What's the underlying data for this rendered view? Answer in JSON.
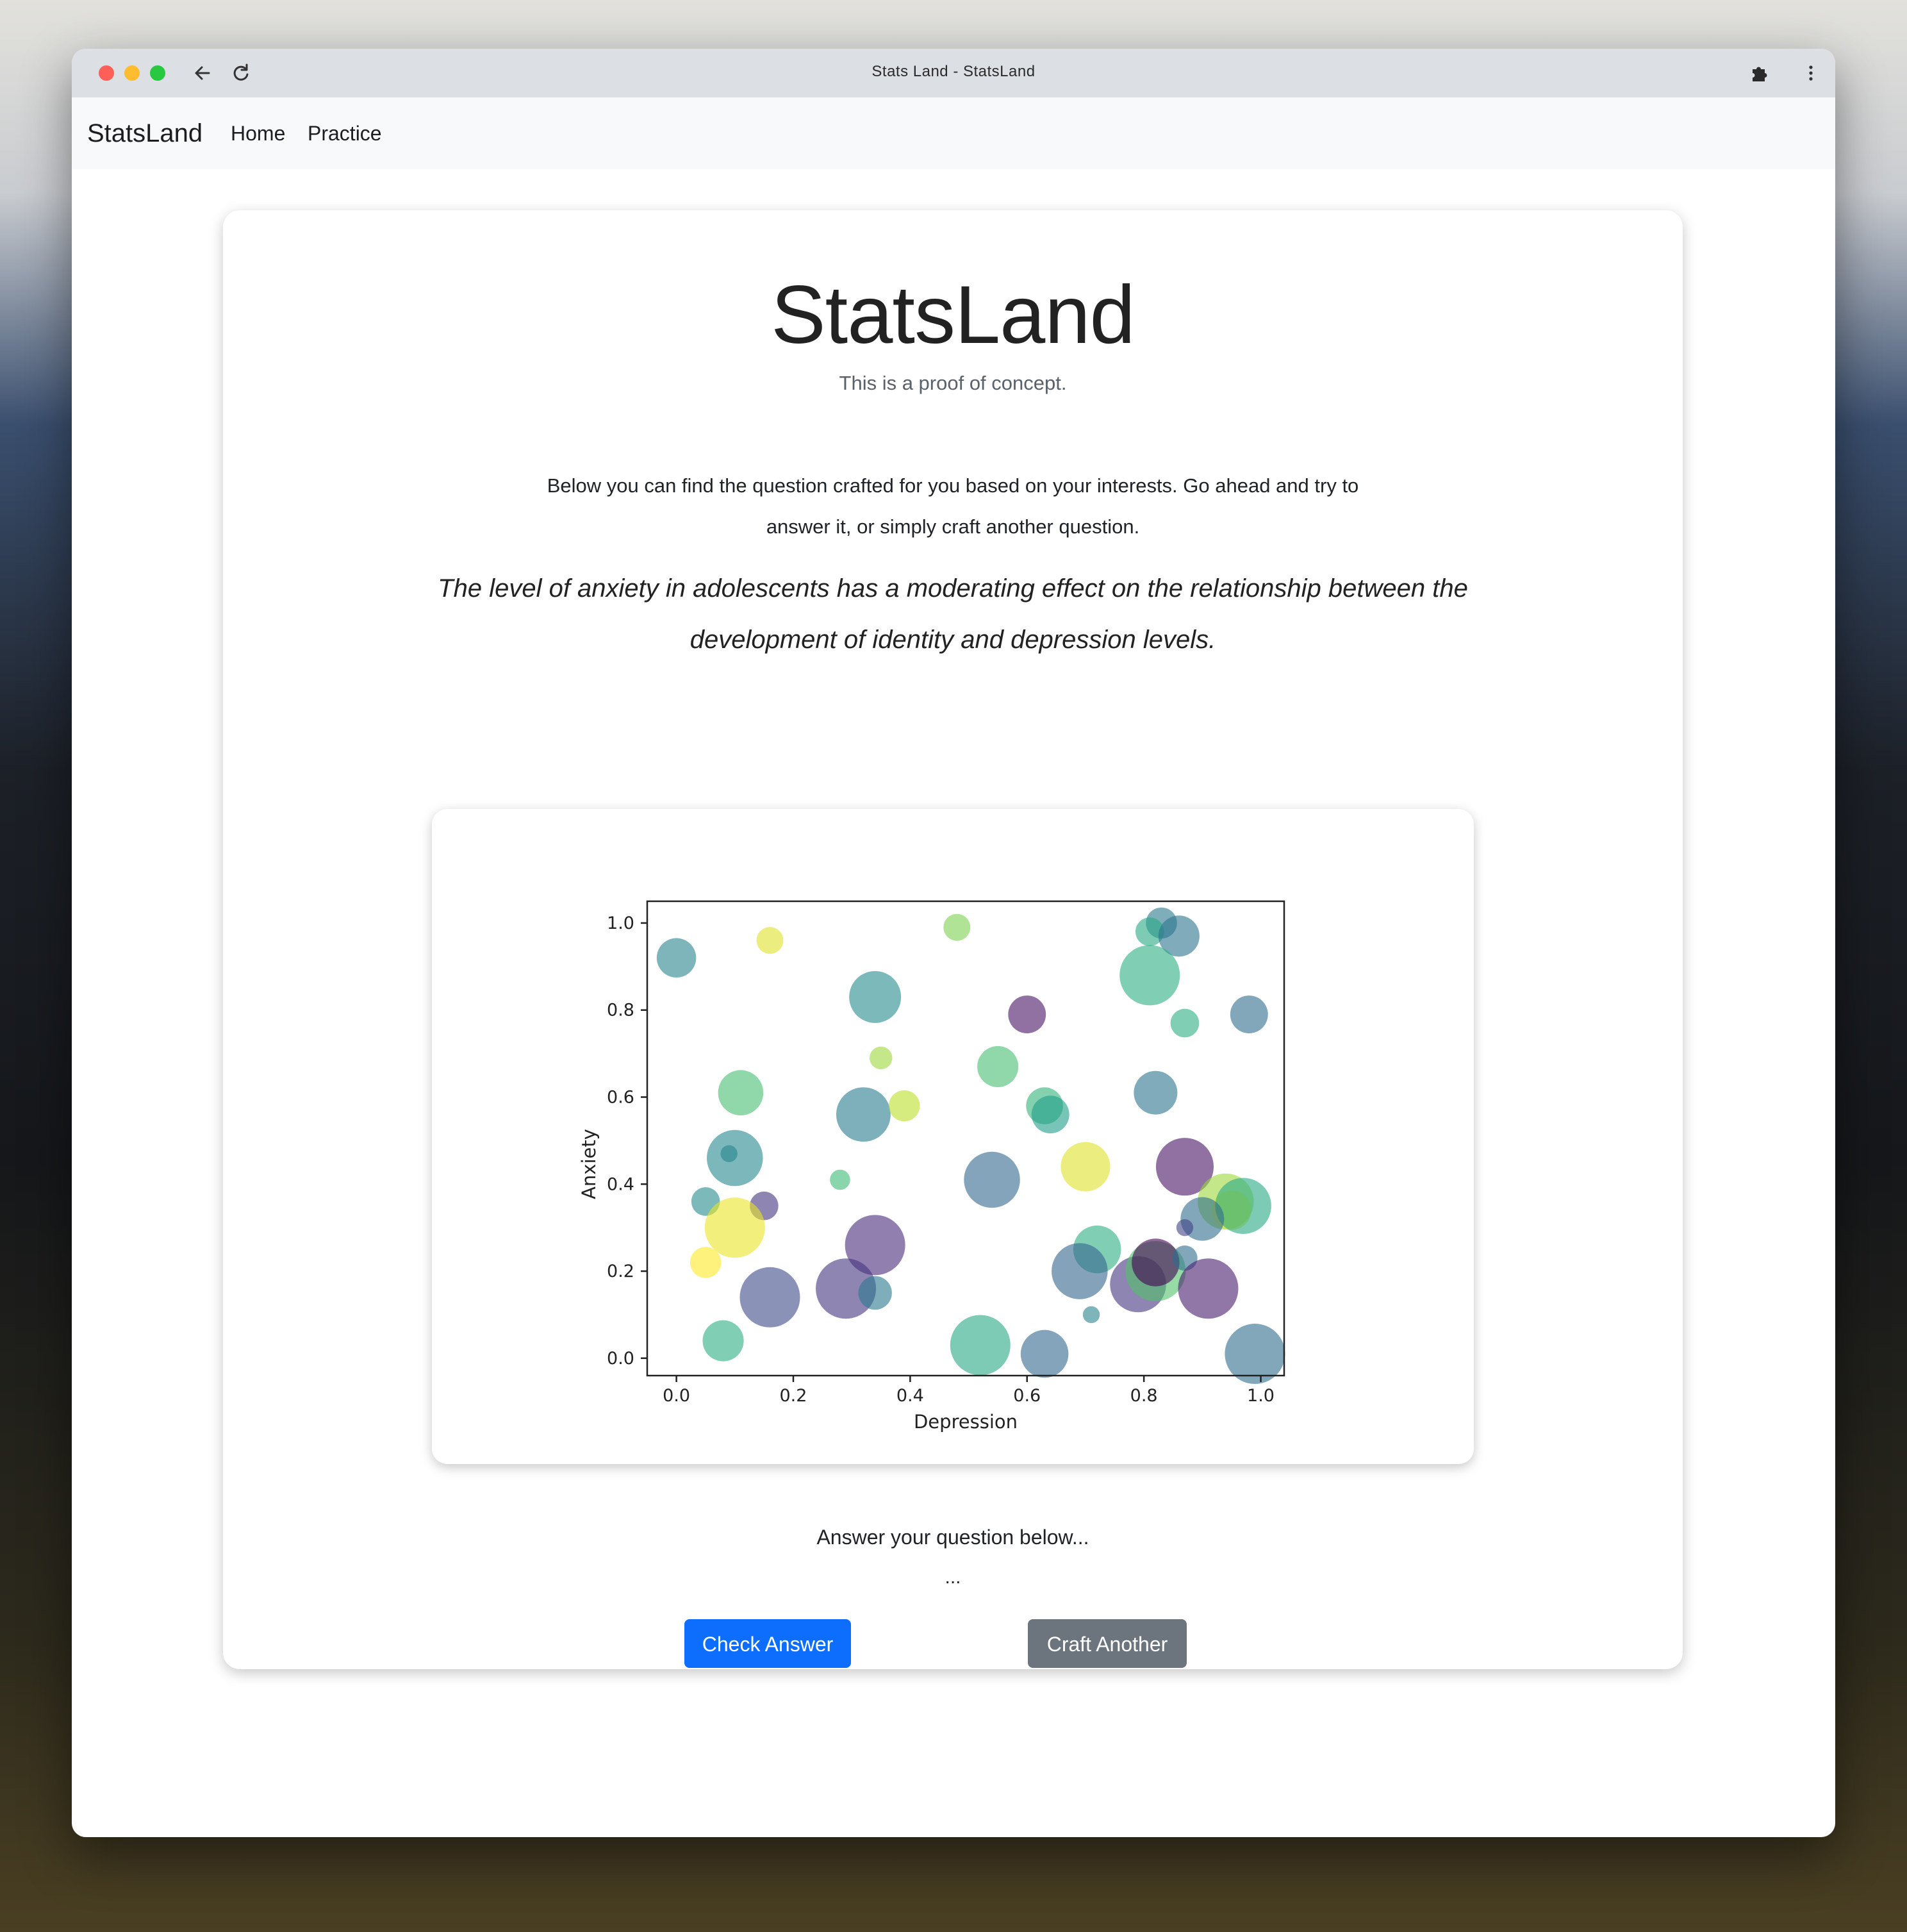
{
  "window": {
    "title": "Stats Land - StatsLand"
  },
  "navbar": {
    "brand": "StatsLand",
    "links": [
      "Home",
      "Practice"
    ]
  },
  "header": {
    "title": "StatsLand",
    "subtitle": "This is a proof of concept."
  },
  "intro": {
    "line1": "Below you can find the question crafted for you based on your interests. Go ahead and try to",
    "line2": "answer it, or simply craft another question."
  },
  "hypothesis": {
    "line1": "The level of anxiety in adolescents has a moderating effect on the relationship between the",
    "line2": "development of identity and depression levels."
  },
  "answer": {
    "prompt": "Answer your question below...",
    "value": "..."
  },
  "buttons": {
    "check": "Check Answer",
    "craft": "Craft Another"
  },
  "icons": {
    "back": "back-arrow-icon",
    "reload": "reload-icon",
    "extensions": "puzzle-icon",
    "menu": "kebab-menu-icon"
  },
  "chart_data": {
    "type": "scatter",
    "xlabel": "Depression",
    "ylabel": "Anxiety",
    "xlim": [
      -0.05,
      1.04
    ],
    "ylim": [
      -0.04,
      1.05
    ],
    "xticks": [
      "0.0",
      "0.2",
      "0.4",
      "0.6",
      "0.8",
      "1.0"
    ],
    "yticks": [
      "0.0",
      "0.2",
      "0.4",
      "0.6",
      "0.8",
      "1.0"
    ],
    "colormap": "viridis",
    "alpha": 0.6,
    "points": [
      {
        "x": 0.0,
        "y": 0.92,
        "size": 0.35,
        "c": 0.45
      },
      {
        "x": 0.16,
        "y": 0.96,
        "size": 0.2,
        "c": 0.95
      },
      {
        "x": 0.48,
        "y": 0.99,
        "size": 0.2,
        "c": 0.8
      },
      {
        "x": 0.83,
        "y": 1.0,
        "size": 0.25,
        "c": 0.4
      },
      {
        "x": 0.81,
        "y": 0.98,
        "size": 0.22,
        "c": 0.6
      },
      {
        "x": 0.86,
        "y": 0.97,
        "size": 0.37,
        "c": 0.38
      },
      {
        "x": 0.81,
        "y": 0.88,
        "size": 0.6,
        "c": 0.62
      },
      {
        "x": 0.34,
        "y": 0.83,
        "size": 0.5,
        "c": 0.48
      },
      {
        "x": 0.6,
        "y": 0.79,
        "size": 0.33,
        "c": 0.05
      },
      {
        "x": 0.87,
        "y": 0.77,
        "size": 0.22,
        "c": 0.62
      },
      {
        "x": 0.98,
        "y": 0.79,
        "size": 0.33,
        "c": 0.35
      },
      {
        "x": 0.35,
        "y": 0.69,
        "size": 0.15,
        "c": 0.85
      },
      {
        "x": 0.55,
        "y": 0.67,
        "size": 0.37,
        "c": 0.7
      },
      {
        "x": 0.11,
        "y": 0.61,
        "size": 0.42,
        "c": 0.7
      },
      {
        "x": 0.32,
        "y": 0.56,
        "size": 0.53,
        "c": 0.42
      },
      {
        "x": 0.39,
        "y": 0.58,
        "size": 0.25,
        "c": 0.9
      },
      {
        "x": 0.63,
        "y": 0.58,
        "size": 0.32,
        "c": 0.65
      },
      {
        "x": 0.64,
        "y": 0.56,
        "size": 0.33,
        "c": 0.55
      },
      {
        "x": 0.82,
        "y": 0.61,
        "size": 0.4,
        "c": 0.38
      },
      {
        "x": 0.1,
        "y": 0.46,
        "size": 0.55,
        "c": 0.47
      },
      {
        "x": 0.09,
        "y": 0.47,
        "size": 0.08,
        "c": 0.45
      },
      {
        "x": 0.28,
        "y": 0.41,
        "size": 0.12,
        "c": 0.68
      },
      {
        "x": 0.54,
        "y": 0.41,
        "size": 0.55,
        "c": 0.33
      },
      {
        "x": 0.7,
        "y": 0.44,
        "size": 0.47,
        "c": 0.95
      },
      {
        "x": 0.87,
        "y": 0.44,
        "size": 0.57,
        "c": 0.05
      },
      {
        "x": 0.05,
        "y": 0.36,
        "size": 0.22,
        "c": 0.48
      },
      {
        "x": 0.15,
        "y": 0.35,
        "size": 0.22,
        "c": 0.15
      },
      {
        "x": 0.1,
        "y": 0.3,
        "size": 0.6,
        "c": 0.97
      },
      {
        "x": 0.34,
        "y": 0.26,
        "size": 0.6,
        "c": 0.12
      },
      {
        "x": 0.72,
        "y": 0.25,
        "size": 0.45,
        "c": 0.62
      },
      {
        "x": 0.94,
        "y": 0.36,
        "size": 0.55,
        "c": 0.85
      },
      {
        "x": 0.95,
        "y": 0.34,
        "size": 0.35,
        "c": 0.95
      },
      {
        "x": 0.97,
        "y": 0.35,
        "size": 0.55,
        "c": 0.6
      },
      {
        "x": 0.9,
        "y": 0.32,
        "size": 0.4,
        "c": 0.35
      },
      {
        "x": 0.87,
        "y": 0.3,
        "size": 0.08,
        "c": 0.2
      },
      {
        "x": 0.05,
        "y": 0.22,
        "size": 0.25,
        "c": 1.0
      },
      {
        "x": 0.16,
        "y": 0.14,
        "size": 0.6,
        "c": 0.22
      },
      {
        "x": 0.29,
        "y": 0.16,
        "size": 0.6,
        "c": 0.15
      },
      {
        "x": 0.34,
        "y": 0.15,
        "size": 0.28,
        "c": 0.4
      },
      {
        "x": 0.69,
        "y": 0.2,
        "size": 0.55,
        "c": 0.32
      },
      {
        "x": 0.79,
        "y": 0.17,
        "size": 0.55,
        "c": 0.15
      },
      {
        "x": 0.82,
        "y": 0.2,
        "size": 0.6,
        "c": 0.72
      },
      {
        "x": 0.82,
        "y": 0.22,
        "size": 0.45,
        "c": 0.0
      },
      {
        "x": 0.87,
        "y": 0.23,
        "size": 0.18,
        "c": 0.35
      },
      {
        "x": 0.91,
        "y": 0.16,
        "size": 0.6,
        "c": 0.08
      },
      {
        "x": 0.08,
        "y": 0.04,
        "size": 0.37,
        "c": 0.62
      },
      {
        "x": 0.52,
        "y": 0.03,
        "size": 0.6,
        "c": 0.6
      },
      {
        "x": 0.63,
        "y": 0.01,
        "size": 0.45,
        "c": 0.33
      },
      {
        "x": 0.71,
        "y": 0.1,
        "size": 0.08,
        "c": 0.45
      },
      {
        "x": 0.99,
        "y": 0.01,
        "size": 0.6,
        "c": 0.35
      }
    ]
  }
}
